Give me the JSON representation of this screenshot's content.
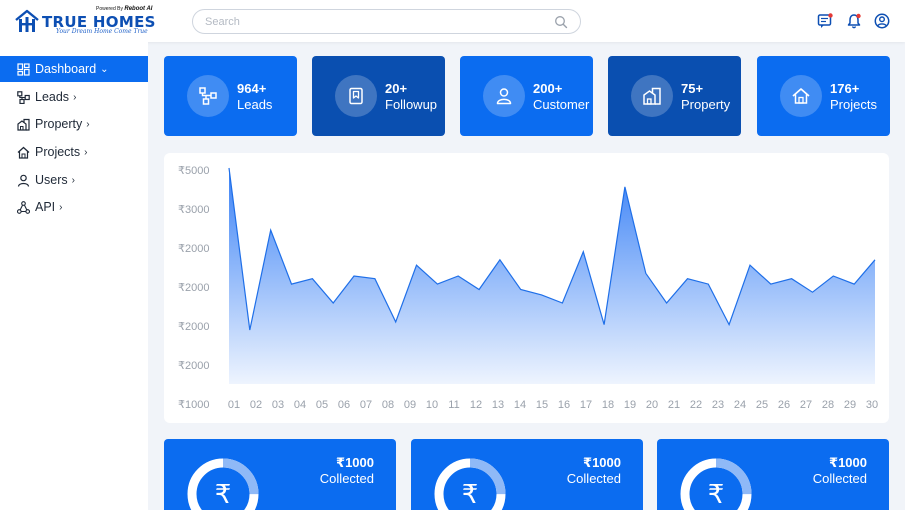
{
  "header": {
    "brand": {
      "powered_prefix": "Powered By",
      "powered_brand": "Reboot AI",
      "title": "TRUE HOMES",
      "tagline": "Your Dream Home Come True"
    },
    "search": {
      "placeholder": "Search",
      "value": ""
    },
    "icons": [
      "messages-icon",
      "notifications-icon",
      "profile-icon"
    ]
  },
  "sidebar": {
    "items": [
      {
        "label": "Dashboard",
        "icon": "dashboard-icon",
        "active": true
      },
      {
        "label": "Leads",
        "icon": "leads-icon"
      },
      {
        "label": "Property",
        "icon": "property-icon"
      },
      {
        "label": "Projects",
        "icon": "projects-icon"
      },
      {
        "label": "Users",
        "icon": "users-icon"
      },
      {
        "label": "API",
        "icon": "api-icon"
      }
    ]
  },
  "stats": [
    {
      "value": "964+",
      "label": "Leads",
      "icon": "leads-icon",
      "color": "#0b6cf0"
    },
    {
      "value": "20+",
      "label": "Followup",
      "icon": "bookmark-icon",
      "color": "#0a4fb0"
    },
    {
      "value": "200+",
      "label": "Customer",
      "icon": "user-icon",
      "color": "#0b6cf0"
    },
    {
      "value": "75+",
      "label": "Property",
      "icon": "property-icon",
      "color": "#0a4fb0"
    },
    {
      "value": "176+",
      "label": "Projects",
      "icon": "home-icon",
      "color": "#0b6cf0"
    }
  ],
  "chart_data": {
    "type": "area",
    "x": [
      "01",
      "02",
      "03",
      "04",
      "05",
      "06",
      "07",
      "08",
      "09",
      "10",
      "11",
      "12",
      "13",
      "14",
      "15",
      "16",
      "17",
      "18",
      "19",
      "20",
      "21",
      "22",
      "23",
      "24",
      "25",
      "26",
      "27",
      "28",
      "29",
      "30"
    ],
    "values": [
      5000,
      2000,
      3850,
      2850,
      2950,
      2500,
      3000,
      2950,
      2150,
      3200,
      2850,
      3000,
      2750,
      3300,
      2750,
      2650,
      2500,
      3450,
      2100,
      4650,
      3050,
      2500,
      2950,
      2850,
      2100,
      3200,
      2850,
      2950,
      2700,
      3000,
      2850,
      3300
    ],
    "y_tick_labels": [
      "₹5000",
      "₹3000",
      "₹2000",
      "₹2000",
      "₹2000",
      "₹2000",
      "₹1000"
    ],
    "ylim": [
      1000,
      5000
    ],
    "grid": false,
    "colors": {
      "line": "#1f6fe8",
      "fill_top": "#3b82f6",
      "fill_bottom": "#eef4fe"
    }
  },
  "collections": [
    {
      "amount": "₹1000",
      "label": "Collected",
      "icon": "rupee-icon",
      "progress": 0.25
    },
    {
      "amount": "₹1000",
      "label": "Collected",
      "icon": "rupee-icon",
      "progress": 0.25
    },
    {
      "amount": "₹1000",
      "label": "Collected",
      "icon": "rupee-icon",
      "progress": 0.25
    }
  ],
  "colors": {
    "accent": "#0b6cf0",
    "accent_dark": "#0a4fb0",
    "background": "#f1f4f9"
  }
}
